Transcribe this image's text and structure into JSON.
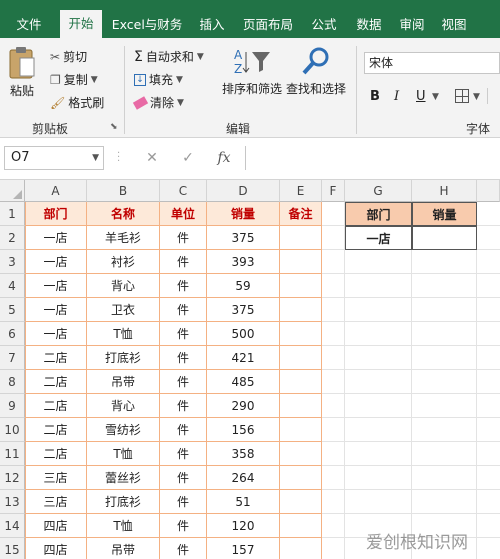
{
  "ribbon_tabs": [
    "文件",
    "开始",
    "Excel与财务",
    "插入",
    "页面布局",
    "公式",
    "数据",
    "审阅",
    "视图"
  ],
  "active_tab": "开始",
  "clipboard": {
    "paste": "粘贴",
    "cut": "剪切",
    "copy": "复制",
    "format_painter": "格式刷",
    "group_label": "剪贴板"
  },
  "editing": {
    "autosum": "自动求和",
    "fill": "填充",
    "clear": "清除",
    "sort_filter": "排序和筛选",
    "find_select": "查找和选择",
    "group_label": "编辑"
  },
  "font": {
    "family": "宋体",
    "bold": "B",
    "italic": "I",
    "underline": "U",
    "group_label": "字体"
  },
  "name_box": "O7",
  "formula_value": "",
  "columns": [
    "A",
    "B",
    "C",
    "D",
    "E",
    "F",
    "G",
    "H"
  ],
  "table": {
    "headers": [
      "部门",
      "名称",
      "单位",
      "销量",
      "备注"
    ],
    "rows": [
      [
        "一店",
        "羊毛衫",
        "件",
        "375",
        ""
      ],
      [
        "一店",
        "衬衫",
        "件",
        "393",
        ""
      ],
      [
        "一店",
        "背心",
        "件",
        "59",
        ""
      ],
      [
        "一店",
        "卫衣",
        "件",
        "375",
        ""
      ],
      [
        "一店",
        "T恤",
        "件",
        "500",
        ""
      ],
      [
        "二店",
        "打底衫",
        "件",
        "421",
        ""
      ],
      [
        "二店",
        "吊带",
        "件",
        "485",
        ""
      ],
      [
        "二店",
        "背心",
        "件",
        "290",
        ""
      ],
      [
        "二店",
        "雪纺衫",
        "件",
        "156",
        ""
      ],
      [
        "二店",
        "T恤",
        "件",
        "358",
        ""
      ],
      [
        "三店",
        "蕾丝衫",
        "件",
        "264",
        ""
      ],
      [
        "三店",
        "打底衫",
        "件",
        "51",
        ""
      ],
      [
        "四店",
        "T恤",
        "件",
        "120",
        ""
      ],
      [
        "四店",
        "吊带",
        "件",
        "157",
        ""
      ]
    ]
  },
  "summary": {
    "headers": [
      "部门",
      "销量"
    ],
    "rows": [
      [
        "一店",
        ""
      ]
    ]
  },
  "watermark": "爱创根知识网",
  "colors": {
    "brand": "#217346",
    "header_fill": "#fde9d9",
    "header_text": "#c00000",
    "summary_header_fill": "#f8cbad",
    "table_border": "#f4b183"
  }
}
